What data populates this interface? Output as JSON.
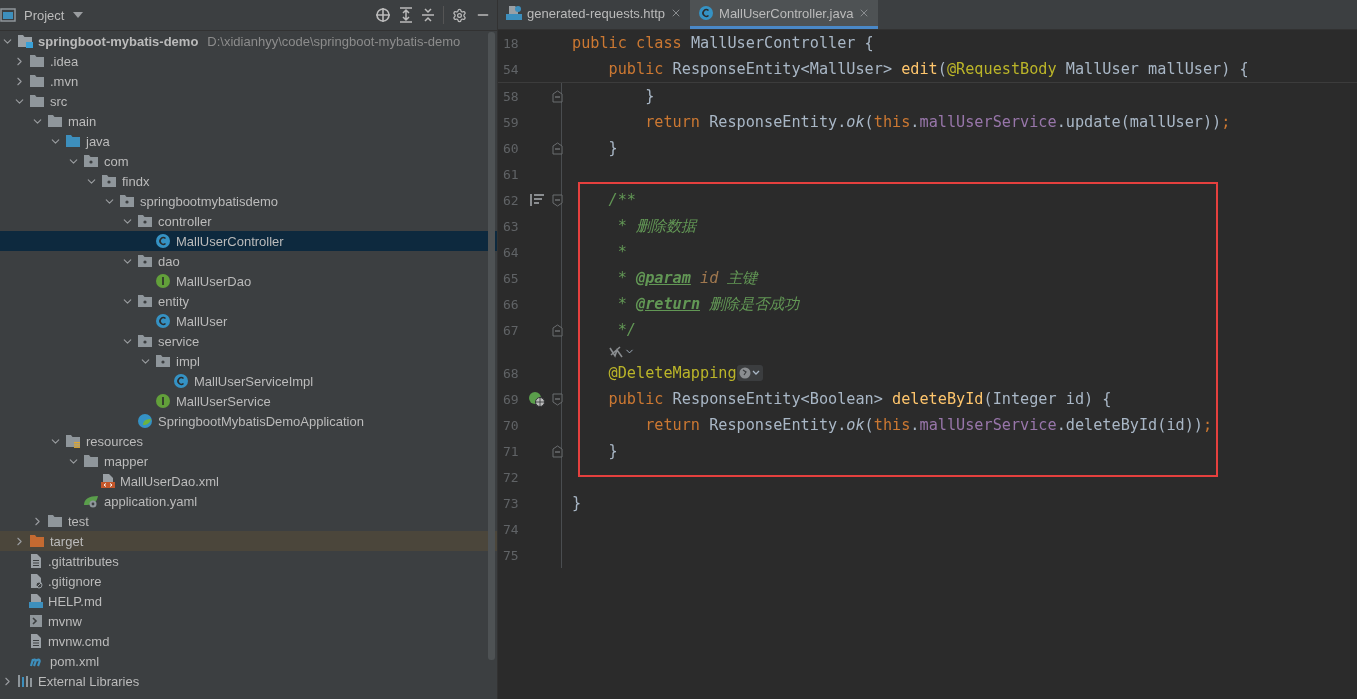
{
  "project_panel": {
    "title": "Project",
    "tree": [
      {
        "label": "springboot-mybatis-demo",
        "path": "D:\\xidianhyy\\code\\springboot-mybatis-demo",
        "kind": "module",
        "expanded": true,
        "selected": false,
        "children": [
          {
            "label": ".idea",
            "kind": "folder",
            "expanded": false,
            "selected": false
          },
          {
            "label": ".mvn",
            "kind": "folder",
            "expanded": false,
            "selected": false
          },
          {
            "label": "src",
            "kind": "folder",
            "expanded": true,
            "selected": false,
            "children": [
              {
                "label": "main",
                "kind": "folder",
                "expanded": true,
                "selected": false,
                "children": [
                  {
                    "label": "java",
                    "kind": "source-folder",
                    "expanded": true,
                    "selected": false,
                    "children": [
                      {
                        "label": "com",
                        "kind": "package",
                        "expanded": true,
                        "selected": false,
                        "children": [
                          {
                            "label": "findx",
                            "kind": "package",
                            "expanded": true,
                            "selected": false,
                            "children": [
                              {
                                "label": "springbootmybatisdemo",
                                "kind": "package",
                                "expanded": true,
                                "selected": false,
                                "children": [
                                  {
                                    "label": "controller",
                                    "kind": "package",
                                    "expanded": true,
                                    "selected": false,
                                    "children": [
                                      {
                                        "label": "MallUserController",
                                        "kind": "class",
                                        "selected": true
                                      }
                                    ]
                                  },
                                  {
                                    "label": "dao",
                                    "kind": "package",
                                    "expanded": true,
                                    "selected": false,
                                    "children": [
                                      {
                                        "label": "MallUserDao",
                                        "kind": "interface",
                                        "selected": false
                                      }
                                    ]
                                  },
                                  {
                                    "label": "entity",
                                    "kind": "package",
                                    "expanded": true,
                                    "selected": false,
                                    "children": [
                                      {
                                        "label": "MallUser",
                                        "kind": "class",
                                        "selected": false
                                      }
                                    ]
                                  },
                                  {
                                    "label": "service",
                                    "kind": "package",
                                    "expanded": true,
                                    "selected": false,
                                    "children": [
                                      {
                                        "label": "impl",
                                        "kind": "package",
                                        "expanded": true,
                                        "selected": false,
                                        "children": [
                                          {
                                            "label": "MallUserServiceImpl",
                                            "kind": "class",
                                            "selected": false
                                          }
                                        ]
                                      },
                                      {
                                        "label": "MallUserService",
                                        "kind": "interface",
                                        "selected": false
                                      }
                                    ]
                                  },
                                  {
                                    "label": "SpringbootMybatisDemoApplication",
                                    "kind": "spring-class",
                                    "selected": false
                                  }
                                ]
                              }
                            ]
                          }
                        ]
                      }
                    ]
                  },
                  {
                    "label": "resources",
                    "kind": "resources-folder",
                    "expanded": true,
                    "selected": false,
                    "children": [
                      {
                        "label": "mapper",
                        "kind": "folder",
                        "expanded": true,
                        "selected": false,
                        "children": [
                          {
                            "label": "MallUserDao.xml",
                            "kind": "xml",
                            "selected": false
                          }
                        ]
                      },
                      {
                        "label": "application.yaml",
                        "kind": "yaml",
                        "selected": false
                      }
                    ]
                  }
                ]
              },
              {
                "label": "test",
                "kind": "folder",
                "expanded": false,
                "selected": false
              }
            ]
          },
          {
            "label": "target",
            "kind": "excluded-folder",
            "expanded": false,
            "selected": false
          },
          {
            "label": ".gitattributes",
            "kind": "file",
            "selected": false
          },
          {
            "label": ".gitignore",
            "kind": "gitignore",
            "selected": false
          },
          {
            "label": "HELP.md",
            "kind": "markdown",
            "selected": false
          },
          {
            "label": "mvnw",
            "kind": "shell",
            "selected": false
          },
          {
            "label": "mvnw.cmd",
            "kind": "file",
            "selected": false
          },
          {
            "label": "pom.xml",
            "kind": "maven",
            "selected": false
          }
        ]
      },
      {
        "label": "External Libraries",
        "kind": "libraries",
        "expanded": false,
        "selected": false
      }
    ]
  },
  "editor": {
    "tabs": [
      {
        "label": "generated-requests.http",
        "kind": "http",
        "selected": false
      },
      {
        "label": "MallUserController.java",
        "kind": "class",
        "selected": true
      }
    ],
    "sticky_lines": [
      {
        "number": "18",
        "tokens": [
          {
            "t": "public class ",
            "kind": "keyword"
          },
          {
            "t": "MallUserController {",
            "kind": "plain"
          }
        ]
      },
      {
        "number": "54",
        "tokens": [
          {
            "t": "    public ",
            "kind": "keyword"
          },
          {
            "t": "ResponseEntity<MallUser> ",
            "kind": "plain"
          },
          {
            "t": "edit",
            "kind": "method"
          },
          {
            "t": "(",
            "kind": "plain"
          },
          {
            "t": "@RequestBody",
            "kind": "annotation"
          },
          {
            "t": " MallUser mallUser) {",
            "kind": "plain"
          }
        ]
      }
    ],
    "blocks": [
      {
        "highlighted": false,
        "lines": [
          {
            "number": "58",
            "fold": {
              "kind": "end"
            },
            "tokens": [
              {
                "t": "        }",
                "kind": "plain"
              }
            ]
          },
          {
            "number": "59",
            "tokens": [
              {
                "t": "        return ",
                "kind": "keyword"
              },
              {
                "t": "ResponseEntity.",
                "kind": "plain"
              },
              {
                "t": "ok",
                "kind": "static"
              },
              {
                "t": "(",
                "kind": "plain"
              },
              {
                "t": "this",
                "kind": "keyword"
              },
              {
                "t": ".",
                "kind": "plain"
              },
              {
                "t": "mallUserService",
                "kind": "field"
              },
              {
                "t": ".update(mallUser))",
                "kind": "plain"
              },
              {
                "t": ";",
                "kind": "keyword"
              }
            ]
          },
          {
            "number": "60",
            "fold": {
              "kind": "end"
            },
            "tokens": [
              {
                "t": "    }",
                "kind": "plain"
              }
            ]
          },
          {
            "number": "61"
          }
        ]
      },
      {
        "highlighted": true,
        "lines": [
          {
            "number": "62",
            "fold": {
              "kind": "start"
            },
            "gutter_icon": {
              "kind": "doc"
            },
            "tokens": [
              {
                "t": "    /**",
                "kind": "comment"
              }
            ]
          },
          {
            "number": "63",
            "tokens": [
              {
                "t": "     * 删除数据",
                "kind": "comment"
              }
            ]
          },
          {
            "number": "64",
            "tokens": [
              {
                "t": "     *",
                "kind": "comment"
              }
            ]
          },
          {
            "number": "65",
            "tokens": [
              {
                "t": "     * ",
                "kind": "comment"
              },
              {
                "t": "@param",
                "kind": "doctag"
              },
              {
                "t": " id",
                "kind": "docparam"
              },
              {
                "t": " 主键",
                "kind": "comment"
              }
            ]
          },
          {
            "number": "66",
            "tokens": [
              {
                "t": "     * ",
                "kind": "comment"
              },
              {
                "t": "@return",
                "kind": "doctag"
              },
              {
                "t": " 删除是否成功",
                "kind": "comment"
              }
            ]
          },
          {
            "number": "67",
            "fold": {
              "kind": "end"
            },
            "tokens": [
              {
                "t": "     */",
                "kind": "comment"
              }
            ]
          },
          {
            "kind": "hint"
          },
          {
            "number": "68",
            "inlay": {
              "kind": "endpoint"
            },
            "tokens": [
              {
                "t": "    @DeleteMapping",
                "kind": "annotation"
              }
            ]
          },
          {
            "number": "69",
            "fold": {
              "kind": "start"
            },
            "gutter_icon": {
              "kind": "endpoint"
            },
            "tokens": [
              {
                "t": "    public ",
                "kind": "keyword"
              },
              {
                "t": "ResponseEntity<Boolean> ",
                "kind": "plain"
              },
              {
                "t": "deleteById",
                "kind": "method"
              },
              {
                "t": "(Integer id) {",
                "kind": "plain"
              }
            ]
          },
          {
            "number": "70",
            "tokens": [
              {
                "t": "        return ",
                "kind": "keyword"
              },
              {
                "t": "ResponseEntity.",
                "kind": "plain"
              },
              {
                "t": "ok",
                "kind": "static"
              },
              {
                "t": "(",
                "kind": "plain"
              },
              {
                "t": "this",
                "kind": "keyword"
              },
              {
                "t": ".",
                "kind": "plain"
              },
              {
                "t": "mallUserService",
                "kind": "field"
              },
              {
                "t": ".deleteById(id))",
                "kind": "plain"
              },
              {
                "t": ";",
                "kind": "keyword"
              }
            ]
          },
          {
            "number": "71",
            "fold": {
              "kind": "end"
            },
            "tokens": [
              {
                "t": "    }",
                "kind": "plain"
              }
            ]
          }
        ]
      },
      {
        "highlighted": false,
        "lines": [
          {
            "number": "72"
          },
          {
            "number": "73",
            "tokens": [
              {
                "t": "}",
                "kind": "plain"
              }
            ]
          },
          {
            "number": "74"
          },
          {
            "number": "75"
          }
        ]
      }
    ]
  }
}
